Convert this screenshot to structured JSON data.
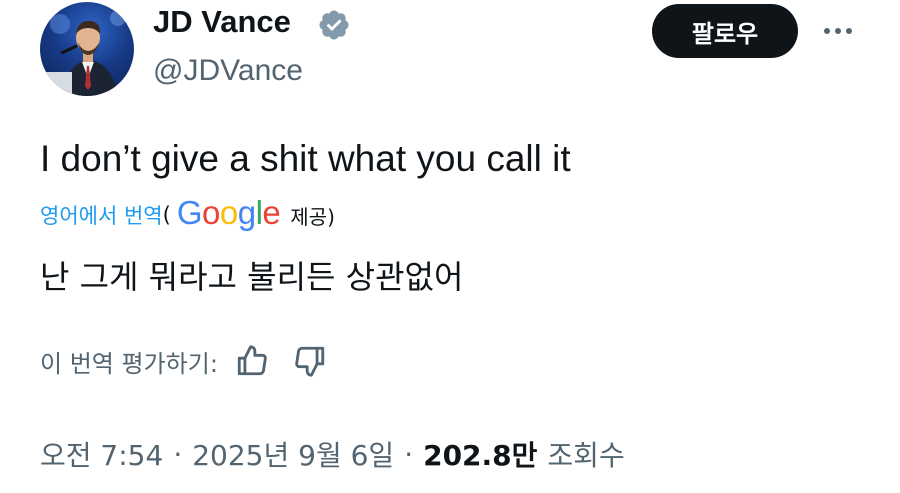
{
  "author": {
    "display_name": "JD Vance",
    "handle": "@JDVance",
    "verified_icon": "verified-badge-icon",
    "avatar": "avatar-photo"
  },
  "follow_label": "팔로우",
  "more_icon": "more-options-icon",
  "tweet": {
    "text": "I don’t give a shit what you call it"
  },
  "translation": {
    "link_label": "영어에서 번역",
    "open_paren": "(",
    "provider": "Google",
    "provided_label": "제공)",
    "text": "난 그게 뭐라고 불리든 상관없어",
    "rate_label": "이 번역 평가하기:",
    "thumbs_up_icon": "thumbs-up-icon",
    "thumbs_down_icon": "thumbs-down-icon"
  },
  "meta": {
    "time": "오전 7:54",
    "separator": "·",
    "date": "2025년 9월 6일",
    "views_count": "202.8만",
    "views_label": "조회수"
  },
  "colors": {
    "accent_link": "#1d9bf0",
    "text_primary": "#0f1419",
    "text_secondary": "#536471",
    "button_bg": "#0f1419",
    "google_blue": "#4285F4",
    "google_red": "#EA4335",
    "google_yellow": "#FBBC05",
    "google_green": "#34A853"
  }
}
